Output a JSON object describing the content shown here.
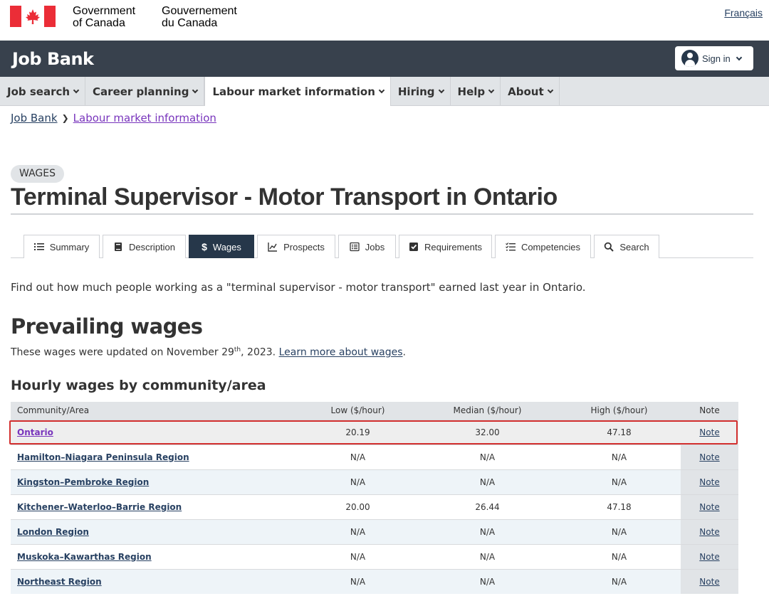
{
  "gov_header": {
    "name_en_line1": "Government",
    "name_en_line2": "of Canada",
    "name_fr_line1": "Gouvernement",
    "name_fr_line2": "du Canada",
    "language_link": "Français",
    "flag_colors": {
      "red": "#eb2d37",
      "white": "#ffffff"
    }
  },
  "app_bar": {
    "title": "Job Bank",
    "sign_in_label": "Sign in",
    "background": "#38414d"
  },
  "nav": {
    "items": [
      {
        "label": "Job search"
      },
      {
        "label": "Career planning"
      },
      {
        "label": "Labour market information"
      },
      {
        "label": "Hiring"
      },
      {
        "label": "Help"
      },
      {
        "label": "About"
      }
    ]
  },
  "breadcrumb": {
    "items": [
      "Job Bank",
      "Labour market information"
    ]
  },
  "page": {
    "badge": "WAGES",
    "title": "Terminal Supervisor - Motor Transport in Ontario",
    "intro": "Find out how much people working as a \"terminal supervisor - motor transport\" earned last year in Ontario.",
    "section_title": "Prevailing wages",
    "updated_prefix": "These wages were updated on November 29",
    "updated_sup": "th",
    "updated_suffix": ", 2023.",
    "learn_more": "Learn more about wages",
    "learn_more_after": ".",
    "table_title": "Hourly wages by community/area"
  },
  "tabs": [
    {
      "label": "Summary",
      "icon": "list-icon"
    },
    {
      "label": "Description",
      "icon": "book-icon"
    },
    {
      "label": "Wages",
      "icon": "dollar-icon"
    },
    {
      "label": "Prospects",
      "icon": "trend-icon"
    },
    {
      "label": "Jobs",
      "icon": "list-alt-icon"
    },
    {
      "label": "Requirements",
      "icon": "checkbox-icon"
    },
    {
      "label": "Competencies",
      "icon": "checklist-icon"
    },
    {
      "label": "Search",
      "icon": "search-icon"
    }
  ],
  "table": {
    "headers": [
      "Community/Area",
      "Low ($/hour)",
      "Median ($/hour)",
      "High ($/hour)",
      "Note"
    ],
    "rows": [
      {
        "area": "Ontario",
        "low": "20.19",
        "median": "32.00",
        "high": "47.18",
        "note": "Note"
      },
      {
        "area": "Hamilton–Niagara Peninsula Region",
        "low": "N/A",
        "median": "N/A",
        "high": "N/A",
        "note": "Note"
      },
      {
        "area": "Kingston–Pembroke Region",
        "low": "N/A",
        "median": "N/A",
        "high": "N/A",
        "note": "Note"
      },
      {
        "area": "Kitchener–Waterloo–Barrie Region",
        "low": "20.00",
        "median": "26.44",
        "high": "47.18",
        "note": "Note"
      },
      {
        "area": "London Region",
        "low": "N/A",
        "median": "N/A",
        "high": "N/A",
        "note": "Note"
      },
      {
        "area": "Muskoka–Kawarthas Region",
        "low": "N/A",
        "median": "N/A",
        "high": "N/A",
        "note": "Note"
      },
      {
        "area": "Northeast Region",
        "low": "N/A",
        "median": "N/A",
        "high": "N/A",
        "note": "Note"
      }
    ]
  },
  "colors": {
    "accent": "#26374a",
    "link": "#284162",
    "visited_link": "#7834bc",
    "highlight_border": "#d3302f"
  }
}
